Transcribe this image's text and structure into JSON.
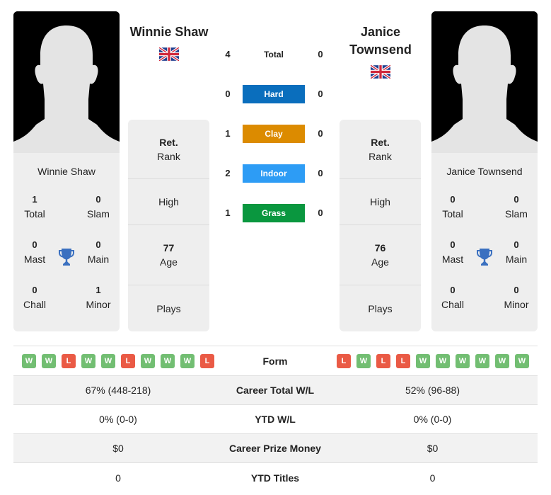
{
  "player_left": {
    "name": "Winnie Shaw",
    "country_flag_icon": "uk-flag-icon",
    "card_name": "Winnie Shaw",
    "titles": {
      "total": {
        "value": "1",
        "label": "Total"
      },
      "slam": {
        "value": "0",
        "label": "Slam"
      },
      "mast": {
        "value": "0",
        "label": "Mast"
      },
      "main": {
        "value": "0",
        "label": "Main"
      },
      "chall": {
        "value": "0",
        "label": "Chall"
      },
      "minor": {
        "value": "1",
        "label": "Minor"
      }
    },
    "info": {
      "rank_value": "Ret.",
      "rank_label": "Rank",
      "high_label": "High",
      "age_value": "77",
      "age_label": "Age",
      "plays_label": "Plays"
    },
    "form": [
      "W",
      "W",
      "L",
      "W",
      "W",
      "L",
      "W",
      "W",
      "W",
      "L"
    ]
  },
  "player_right": {
    "name": "Janice Townsend",
    "country_flag_icon": "uk-flag-icon",
    "card_name": "Janice Townsend",
    "titles": {
      "total": {
        "value": "0",
        "label": "Total"
      },
      "slam": {
        "value": "0",
        "label": "Slam"
      },
      "mast": {
        "value": "0",
        "label": "Mast"
      },
      "main": {
        "value": "0",
        "label": "Main"
      },
      "chall": {
        "value": "0",
        "label": "Chall"
      },
      "minor": {
        "value": "0",
        "label": "Minor"
      }
    },
    "info": {
      "rank_value": "Ret.",
      "rank_label": "Rank",
      "high_label": "High",
      "age_value": "76",
      "age_label": "Age",
      "plays_label": "Plays"
    },
    "form": [
      "L",
      "W",
      "L",
      "L",
      "W",
      "W",
      "W",
      "W",
      "W",
      "W"
    ]
  },
  "h2h": [
    {
      "label": "Total",
      "left": "4",
      "right": "0",
      "color": ""
    },
    {
      "label": "Hard",
      "left": "0",
      "right": "0",
      "color": "#0a6ebd"
    },
    {
      "label": "Clay",
      "left": "1",
      "right": "0",
      "color": "#dc8b00"
    },
    {
      "label": "Indoor",
      "left": "2",
      "right": "0",
      "color": "#2d9cf5"
    },
    {
      "label": "Grass",
      "left": "1",
      "right": "0",
      "color": "#0a973f"
    }
  ],
  "stats": {
    "form_label": "Form",
    "rows": [
      {
        "label": "Career Total W/L",
        "left": "67% (448-218)",
        "right": "52% (96-88)"
      },
      {
        "label": "YTD W/L",
        "left": "0% (0-0)",
        "right": "0% (0-0)"
      },
      {
        "label": "Career Prize Money",
        "left": "$0",
        "right": "$0"
      },
      {
        "label": "YTD Titles",
        "left": "0",
        "right": "0"
      }
    ]
  },
  "colors": {
    "win": "#72be72",
    "loss": "#ea5a45",
    "trophy": "#3a70c0"
  }
}
